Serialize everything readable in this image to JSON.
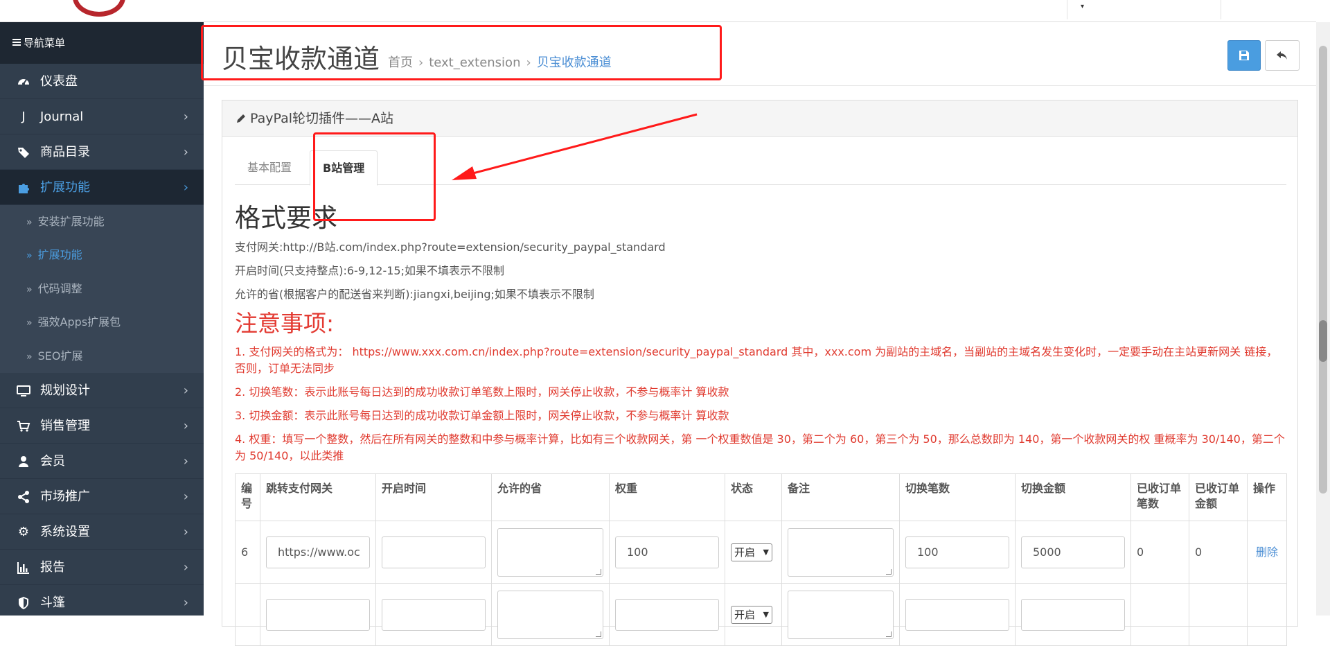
{
  "sidebar": {
    "heading": "导航菜单",
    "items": [
      {
        "icon": "dashboard-icon",
        "label": "仪表盘",
        "chevron": false
      },
      {
        "icon": "journal-icon",
        "label": "Journal",
        "chevron": true
      },
      {
        "icon": "tags-icon",
        "label": "商品目录",
        "chevron": true
      },
      {
        "icon": "puzzle-icon",
        "label": "扩展功能",
        "chevron": true,
        "active": true
      }
    ],
    "sub_items": [
      {
        "label": "安装扩展功能"
      },
      {
        "label": "扩展功能",
        "active": true
      },
      {
        "label": "代码调整"
      },
      {
        "label": "强效Apps扩展包"
      },
      {
        "label": "SEO扩展"
      }
    ],
    "items_after": [
      {
        "icon": "desktop-icon",
        "label": "规划设计"
      },
      {
        "icon": "cart-icon",
        "label": "销售管理"
      },
      {
        "icon": "user-icon",
        "label": "会员"
      },
      {
        "icon": "share-icon",
        "label": "市场推广"
      },
      {
        "icon": "gear-icon",
        "label": "系统设置"
      },
      {
        "icon": "bar-chart-icon",
        "label": "报告"
      },
      {
        "icon": "shield-icon",
        "label": "斗篷"
      }
    ]
  },
  "header": {
    "title": "贝宝收款通道",
    "breadcrumb": [
      "首页",
      "text_extension",
      "贝宝收款通道"
    ]
  },
  "panel": {
    "heading": "PayPal轮切插件——A站",
    "tabs": [
      {
        "label": "基本配置",
        "active": false
      },
      {
        "label": "B站管理",
        "active": true
      }
    ]
  },
  "format": {
    "title": "格式要求",
    "lines": [
      "支付网关:http://B站.com/index.php?route=extension/security_paypal_standard",
      "开启时间(只支持整点):6-9,12-15;如果不填表示不限制",
      "允许的省(根据客户的配送省来判断):jiangxi,beijing;如果不填表示不限制"
    ]
  },
  "notice": {
    "title": "注意事项:",
    "lines": [
      "1. 支付网关的格式为： https://www.xxx.com.cn/index.php?route=extension/security_paypal_standard 其中，xxx.com 为副站的主域名，当副站的主域名发生变化时，一定要手动在主站更新网关 链接，否则，订单无法同步",
      "2. 切换笔数：表示此账号每日达到的成功收款订单笔数上限时，网关停止收款，不参与概率计 算收款",
      "3. 切换金额：表示此账号每日达到的成功收款订单金额上限时，网关停止收款，不参与概率计 算收款",
      "4. 权重：填写一个整数，然后在所有网关的整数和中参与概率计算，比如有三个收款网关，第 一个权重数值是 30，第二个为 60，第三个为 50，那么总数即为 140，第一个收款网关的权 重概率为 30/140，第二个为 50/140，以此类推"
    ]
  },
  "table": {
    "headers": [
      "编号",
      "跳转支付网关",
      "开启时间",
      "允许的省",
      "权重",
      "状态",
      "备注",
      "切换笔数",
      "切换金额",
      "已收订单笔数",
      "已收订单金额",
      "操作"
    ],
    "rows": [
      {
        "id": "6",
        "gateway": "https://www.oc",
        "open_time": "",
        "provinces": "",
        "weight": "100",
        "status": "开启",
        "remark": "",
        "switch_count": "100",
        "switch_amount": "5000",
        "received_count": "0",
        "received_amount": "0",
        "action": "删除"
      },
      {
        "id": "",
        "gateway": "",
        "open_time": "",
        "provinces": "",
        "weight": "",
        "status": "开启",
        "remark": "",
        "switch_count": "",
        "switch_amount": "",
        "received_count": "",
        "received_amount": "",
        "action": ""
      }
    ]
  },
  "colors": {
    "accent": "#4b9ee2",
    "annotation": "#ff1a1a",
    "notice": "#e03a2f"
  }
}
